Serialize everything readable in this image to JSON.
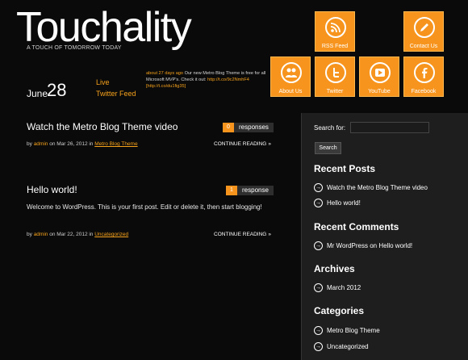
{
  "header": {
    "title": "Touchality",
    "tagline": "A TOUCH OF TOMORROW TODAY",
    "date_month": "June",
    "date_day": "28",
    "live": "Live",
    "twitter_feed": "Twitter Feed",
    "tweet": {
      "time": "about 27 days ago",
      "text": "Our new Metro Blog Theme is free for all Microsoft MVP's. Check it out:",
      "link1": "http://t.co/9c2NmhF4",
      "link2": "[http://t.co/du1fig35]"
    }
  },
  "tiles": [
    {
      "label": "RSS Feed",
      "icon": "rss-icon"
    },
    {
      "label": "Contact Us",
      "icon": "pencil-icon"
    },
    {
      "label": "About Us",
      "icon": "people-icon"
    },
    {
      "label": "Twitter",
      "icon": "twitter-icon"
    },
    {
      "label": "YouTube",
      "icon": "youtube-icon"
    },
    {
      "label": "Facebook",
      "icon": "facebook-icon"
    }
  ],
  "posts": [
    {
      "title": "Watch the Metro Blog Theme video",
      "responses_count": "0",
      "responses_label": "responses",
      "meta_by": "by",
      "author": "admin",
      "date": "on Mar 26, 2012 in",
      "category": "Metro Blog Theme",
      "continue": "CONTINUE READING"
    },
    {
      "title": "Hello world!",
      "responses_count": "1",
      "responses_label": "response",
      "excerpt": "Welcome to WordPress. This is your first post. Edit or delete it, then start blogging!",
      "meta_by": "by",
      "author": "admin",
      "date": "on Mar 22, 2012 in",
      "category": "Uncategorized",
      "continue": "CONTINUE READING"
    }
  ],
  "sidebar": {
    "search_label": "Search for:",
    "search_value": "",
    "search_button": "Search",
    "recent_posts_title": "Recent Posts",
    "recent_posts": [
      "Watch the Metro Blog Theme video",
      "Hello world!"
    ],
    "recent_comments_title": "Recent Comments",
    "recent_comment_author": "Mr WordPress",
    "recent_comment_on": "on",
    "recent_comment_post": "Hello world!",
    "archives_title": "Archives",
    "archives": [
      "March 2012"
    ],
    "categories_title": "Categories",
    "categories": [
      "Metro Blog Theme",
      "Uncategorized"
    ]
  },
  "colors": {
    "accent": "#f7941d",
    "background": "#0a0a0a",
    "sidebar": "#1e1e1e"
  }
}
